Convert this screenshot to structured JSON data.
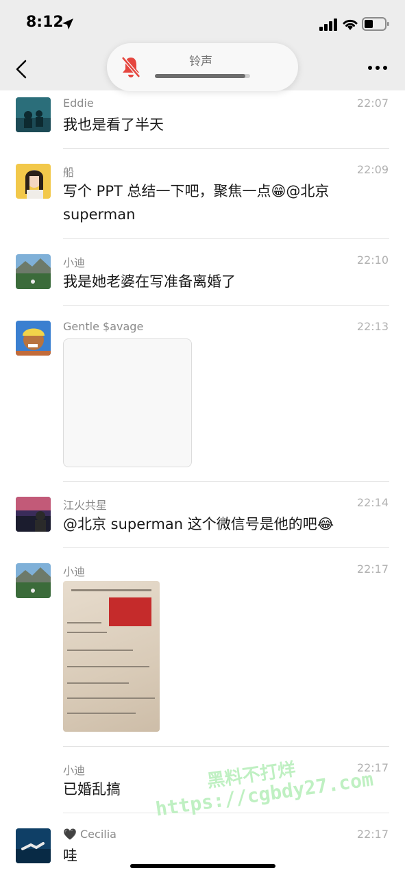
{
  "status_bar": {
    "time": "8:12"
  },
  "ringer": {
    "label": "铃声",
    "level": 0.95
  },
  "messages": [
    {
      "name": "Eddie",
      "time": "22:07",
      "text": "我也是看了半天"
    },
    {
      "name": "船",
      "time": "22:09",
      "text": "写个 PPT 总结一下吧，聚焦一点😁@北京 superman"
    },
    {
      "name": "小迪",
      "time": "22:10",
      "text": "我是她老婆在写准备离婚了"
    },
    {
      "name": "Gentle $avage",
      "time": "22:13"
    },
    {
      "name": "江火共星",
      "time": "22:14",
      "text": "@北京 superman 这个微信号是他的吧😂"
    },
    {
      "name": "小迪",
      "time": "22:17"
    },
    {
      "name": "小迪",
      "time": "22:17",
      "text": "已婚乱搞"
    },
    {
      "name": "🖤 Cecilia",
      "time": "22:17",
      "text": "哇"
    }
  ],
  "watermark": {
    "line1": "黑料不打烊",
    "line2": "https://cgbdy27.com"
  }
}
